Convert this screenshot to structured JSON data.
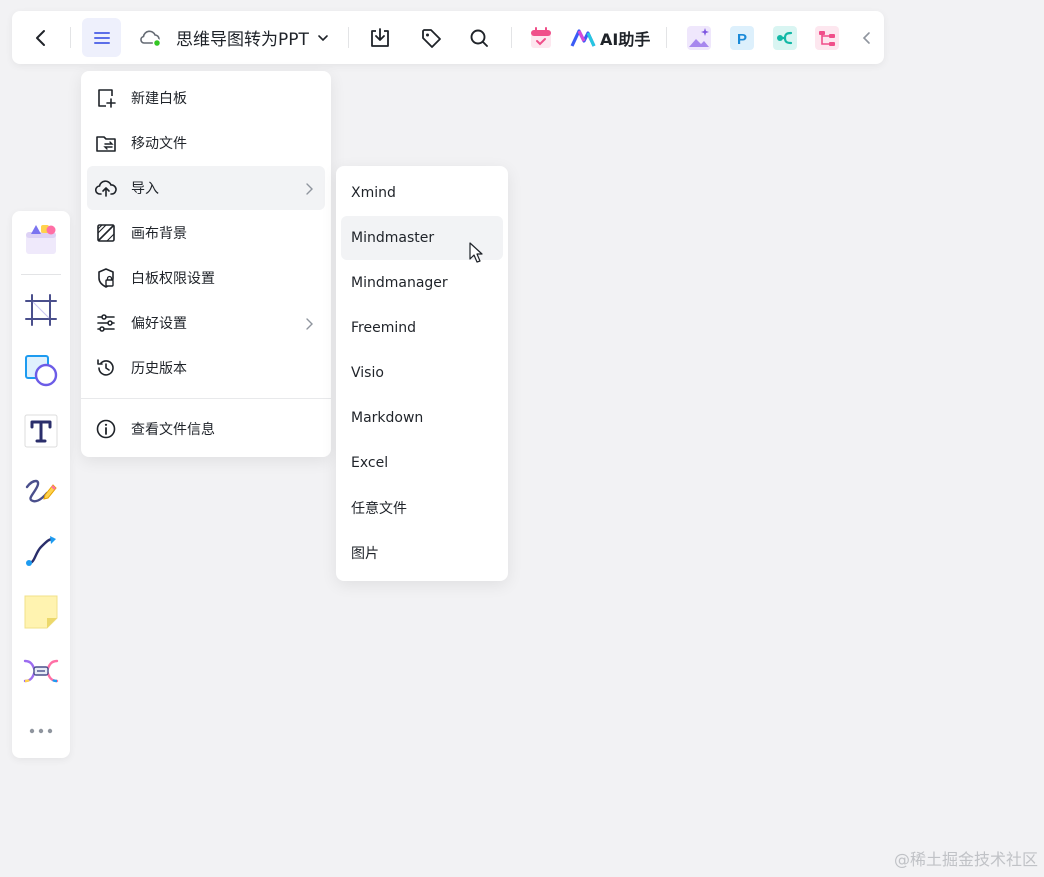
{
  "toolbar": {
    "doc_title": "思维导图转为PPT",
    "ai_label": "AI助手",
    "icons": [
      "back-icon",
      "menu-icon",
      "cloud-sync-icon",
      "chevron-down-icon",
      "download-icon",
      "tag-icon",
      "search-icon",
      "calendar-app-icon",
      "ai-logo-icon",
      "image-gen-app-icon",
      "ppt-app-icon",
      "mindmap-app-icon",
      "flowchart-app-icon",
      "collapse-icon"
    ]
  },
  "main_menu": {
    "items": [
      {
        "label": "新建白板",
        "icon": "new-board-icon"
      },
      {
        "label": "移动文件",
        "icon": "move-folder-icon"
      },
      {
        "label": "导入",
        "icon": "cloud-upload-icon",
        "has_submenu": true,
        "active": true
      },
      {
        "label": "画布背景",
        "icon": "canvas-background-icon"
      },
      {
        "label": "白板权限设置",
        "icon": "permission-shield-icon"
      },
      {
        "label": "偏好设置",
        "icon": "sliders-icon",
        "has_submenu": true
      },
      {
        "label": "历史版本",
        "icon": "history-icon"
      },
      {
        "label": "查看文件信息",
        "icon": "info-icon"
      }
    ]
  },
  "import_submenu": {
    "items": [
      "Xmind",
      "Mindmaster",
      "Mindmanager",
      "Freemind",
      "Visio",
      "Markdown",
      "Excel",
      "任意文件",
      "图片"
    ],
    "hovered": "Mindmaster"
  },
  "tool_panel": {
    "tools": [
      "templates-icon",
      "frame-icon",
      "shapes-icon",
      "text-icon",
      "pen-icon",
      "connector-icon",
      "sticky-note-icon",
      "mindmap-tool-icon",
      "more-icon"
    ]
  },
  "watermark": "@稀土掘金技术社区",
  "colors": {
    "accent": "#5b6ee8",
    "menu_active_bg": "#eef0fc",
    "hover_bg": "#f2f3f5",
    "canvas_bg": "#f2f2f4"
  }
}
